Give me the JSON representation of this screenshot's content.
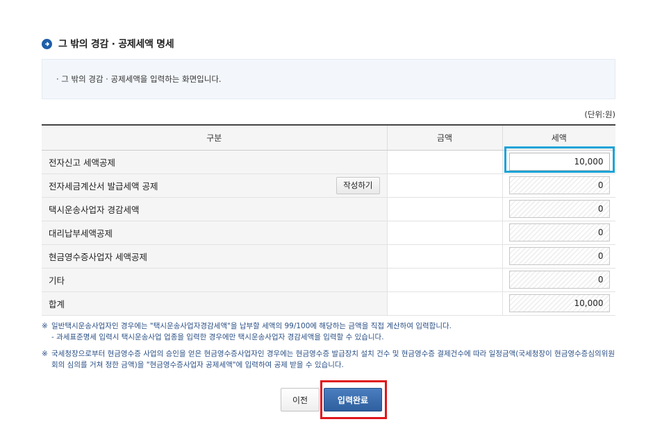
{
  "section": {
    "title": "그 밖의 경감 · 공제세액 명세"
  },
  "info": {
    "text": "· 그 밖의 경감 · 공제세액을 입력하는 화면입니다."
  },
  "unit": "(단위:원)",
  "table": {
    "headers": {
      "category": "구분",
      "amount": "금액",
      "tax": "세액"
    },
    "rows": [
      {
        "label": "전자신고 세액공제",
        "tax": "10,000",
        "editable": true
      },
      {
        "label": "전자세금계산서 발급세액 공제",
        "button": "작성하기",
        "tax": "0",
        "editable": false
      },
      {
        "label": "택시운송사업자 경감세액",
        "tax": "0",
        "editable": false
      },
      {
        "label": "대리납부세액공제",
        "tax": "0",
        "editable": false
      },
      {
        "label": "현금영수증사업자 세액공제",
        "tax": "0",
        "editable": false
      },
      {
        "label": "기타",
        "tax": "0",
        "editable": false
      },
      {
        "label": "합계",
        "tax": "10,000",
        "editable": false
      }
    ]
  },
  "notes": {
    "mark": "※",
    "note1": "일반택시운송사업자인 경우에는 \"택시운송사업자경감세액\"을 납부할 세액의 99/100에 해당하는 금액을 직접 계산하여 입력합니다.",
    "note1_sub": "- 과세표준명세 입력시 택시운송사업 업종을 입력한 경우에만 택시운송사업자 경감세액을 입력할 수 있습니다.",
    "note2": "국세청장으로부터 현금영수증 사업의 승인을 얻은 현금영수증사업자인 경우에는 현금영수증 발급장치 설치 건수 및 현금영수증 결제건수에 따라 일정금액(국세청장이 현금영수증심의위원회의 심의를 거쳐 정한 금액)을 \"현금영수증사업자 공제세액\"에 입력하여 공제 받을 수 있습니다."
  },
  "buttons": {
    "prev": "이전",
    "submit": "입력완료"
  },
  "colors": {
    "accent": "#1f5ea8",
    "highlight_blue": "#1ba3d8",
    "highlight_red": "#e0151c",
    "note_text": "#2a4f85"
  }
}
